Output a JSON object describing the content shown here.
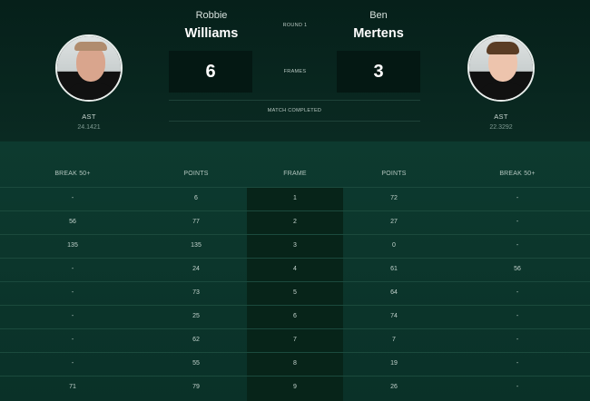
{
  "match": {
    "round": "ROUND 1",
    "frames_label": "FRAMES",
    "status": "MATCH COMPLETED"
  },
  "player1": {
    "first_name": "Robbie",
    "last_name": "Williams",
    "score": "6",
    "nationality": "AST",
    "rank": "24.1421"
  },
  "player2": {
    "first_name": "Ben",
    "last_name": "Mertens",
    "score": "3",
    "nationality": "AST",
    "rank": "22.3292"
  },
  "table": {
    "headers": [
      "BREAK 50+",
      "POINTS",
      "FRAME",
      "POINTS",
      "BREAK 50+"
    ],
    "rows": [
      [
        "-",
        "6",
        "1",
        "72",
        "-"
      ],
      [
        "56",
        "77",
        "2",
        "27",
        "-"
      ],
      [
        "135",
        "135",
        "3",
        "0",
        "-"
      ],
      [
        "-",
        "24",
        "4",
        "61",
        "56"
      ],
      [
        "-",
        "73",
        "5",
        "64",
        "-"
      ],
      [
        "-",
        "25",
        "6",
        "74",
        "-"
      ],
      [
        "-",
        "62",
        "7",
        "7",
        "-"
      ],
      [
        "-",
        "55",
        "8",
        "19",
        "-"
      ],
      [
        "71",
        "79",
        "9",
        "26",
        "-"
      ]
    ]
  },
  "colors": {
    "background": "#0b2c24",
    "header_background": "#06201a",
    "score_box": "#041813",
    "frame_column": "#072419",
    "row_divider": "#1b4a3d"
  }
}
